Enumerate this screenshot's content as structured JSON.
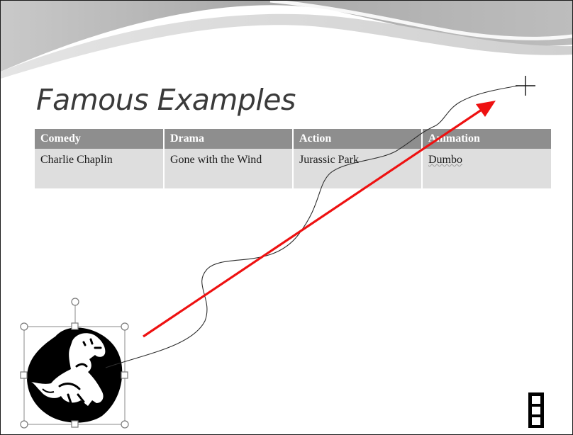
{
  "slide": {
    "title": "Famous Examples",
    "table": {
      "headers": [
        "Comedy",
        "Drama",
        "Action",
        "Animation"
      ],
      "rows": [
        [
          "Charlie Chaplin",
          "Gone with the Wind",
          "Jurassic Park",
          "Dumbo"
        ]
      ]
    }
  },
  "icons": {
    "clip_art": "dinosaur-clipart-icon",
    "rotation_handle": "rotation-handle-icon",
    "motion_path_end": "crosshair-cursor-icon",
    "motion_arrow": "motion-path-arrow-icon",
    "media": "film-strip-icon"
  },
  "colors": {
    "table_header": "#8e8e8e",
    "table_cell": "#dedede",
    "motion_arrow": "#ee1111",
    "title_text": "#3a3a3a"
  }
}
